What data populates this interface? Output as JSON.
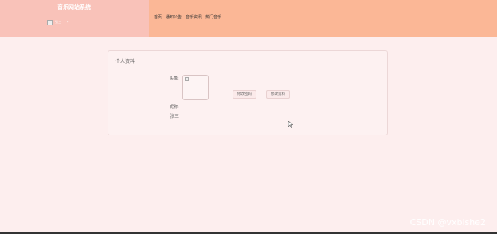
{
  "app": {
    "title": "音乐网站系统"
  },
  "user": {
    "name": "张三",
    "caret": "▾"
  },
  "nav": [
    {
      "label": "首页"
    },
    {
      "label": "通知公告"
    },
    {
      "label": "音乐资讯"
    },
    {
      "label": "热门音乐"
    }
  ],
  "profile": {
    "title": "个人资料",
    "avatar_label": "头像:",
    "nickname_label": "昵称:",
    "nickname_value": "张三",
    "change_password_button": "修改密码",
    "edit_profile_button": "修改资料"
  },
  "watermark": "CSDN @vxbishe2",
  "colors": {
    "sidebar_bg": "#f9c2b9",
    "topbar_bg": "#fbb796",
    "page_bg": "#fdeeee"
  }
}
